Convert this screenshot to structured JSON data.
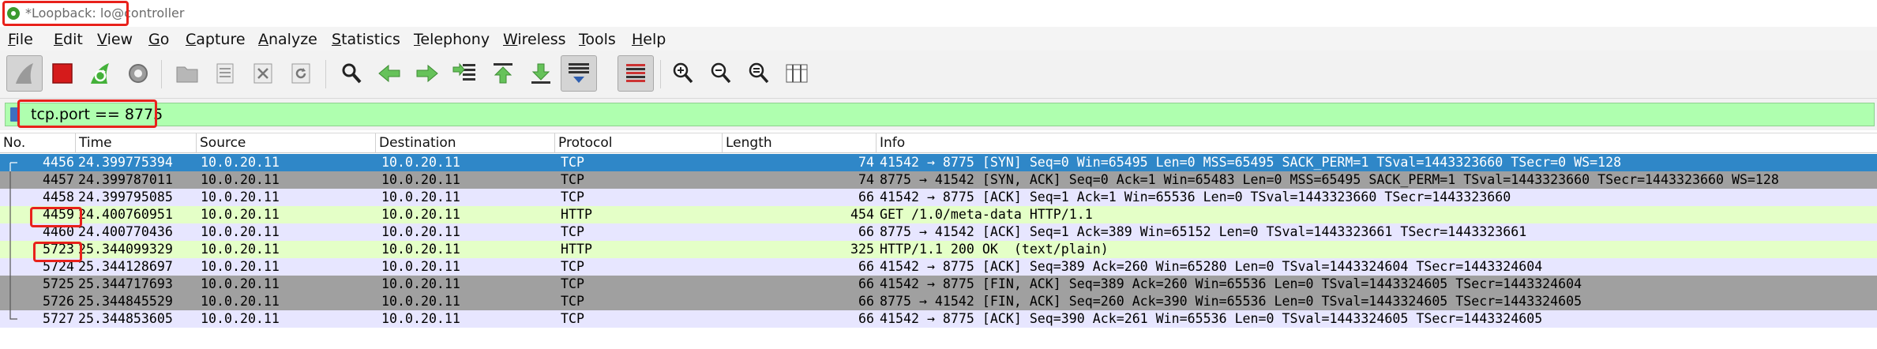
{
  "window": {
    "title": "*Loopback: lo@controller"
  },
  "menu": [
    "File",
    "Edit",
    "View",
    "Go",
    "Capture",
    "Analyze",
    "Statistics",
    "Telephony",
    "Wireless",
    "Tools",
    "Help"
  ],
  "toolbar": {
    "icons": [
      "shark-fin-start-icon",
      "stop-square-icon",
      "restart-fin-icon",
      "capture-options-gear-icon",
      "open-folder-icon",
      "save-file-icon",
      "close-file-icon",
      "reload-icon",
      "find-magnifier-icon",
      "go-back-arrow-icon",
      "go-forward-arrow-icon",
      "go-to-packet-icon",
      "first-packet-icon",
      "last-packet-icon",
      "autoscroll-icon",
      "colorize-icon",
      "zoom-in-icon",
      "zoom-out-icon",
      "normal-size-icon",
      "resize-columns-icon"
    ]
  },
  "filter": {
    "value": "tcp.port == 8775"
  },
  "columns": [
    "No.",
    "Time",
    "Source",
    "Destination",
    "Protocol",
    "Length",
    "Info"
  ],
  "rows": [
    {
      "no": "4456",
      "time": "24.399775394",
      "src": "10.0.20.11",
      "dst": "10.0.20.11",
      "proto": "TCP",
      "len": "74",
      "info": "41542 → 8775 [SYN] Seq=0 Win=65495 Len=0 MSS=65495 SACK_PERM=1 TSval=1443323660 TSecr=0 WS=128",
      "style": "selected"
    },
    {
      "no": "4457",
      "time": "24.399787011",
      "src": "10.0.20.11",
      "dst": "10.0.20.11",
      "proto": "TCP",
      "len": "74",
      "info": "8775 → 41542 [SYN, ACK] Seq=0 Ack=1 Win=65483 Len=0 MSS=65495 SACK_PERM=1 TSval=1443323660 TSecr=1443323660 WS=128",
      "style": "dark"
    },
    {
      "no": "4458",
      "time": "24.399795085",
      "src": "10.0.20.11",
      "dst": "10.0.20.11",
      "proto": "TCP",
      "len": "66",
      "info": "41542 → 8775 [ACK] Seq=1 Ack=1 Win=65536 Len=0 TSval=1443323660 TSecr=1443323660",
      "style": "tcp"
    },
    {
      "no": "4459",
      "time": "24.400760951",
      "src": "10.0.20.11",
      "dst": "10.0.20.11",
      "proto": "HTTP",
      "len": "454",
      "info": "GET /1.0/meta-data HTTP/1.1",
      "style": "http"
    },
    {
      "no": "4460",
      "time": "24.400770436",
      "src": "10.0.20.11",
      "dst": "10.0.20.11",
      "proto": "TCP",
      "len": "66",
      "info": "8775 → 41542 [ACK] Seq=1 Ack=389 Win=65152 Len=0 TSval=1443323661 TSecr=1443323661",
      "style": "tcp"
    },
    {
      "no": "5723",
      "time": "25.344099329",
      "src": "10.0.20.11",
      "dst": "10.0.20.11",
      "proto": "HTTP",
      "len": "325",
      "info": "HTTP/1.1 200 OK  (text/plain)",
      "style": "http"
    },
    {
      "no": "5724",
      "time": "25.344128697",
      "src": "10.0.20.11",
      "dst": "10.0.20.11",
      "proto": "TCP",
      "len": "66",
      "info": "41542 → 8775 [ACK] Seq=389 Ack=260 Win=65280 Len=0 TSval=1443324604 TSecr=1443324604",
      "style": "tcp"
    },
    {
      "no": "5725",
      "time": "25.344717693",
      "src": "10.0.20.11",
      "dst": "10.0.20.11",
      "proto": "TCP",
      "len": "66",
      "info": "41542 → 8775 [FIN, ACK] Seq=389 Ack=260 Win=65536 Len=0 TSval=1443324605 TSecr=1443324604",
      "style": "dark"
    },
    {
      "no": "5726",
      "time": "25.344845529",
      "src": "10.0.20.11",
      "dst": "10.0.20.11",
      "proto": "TCP",
      "len": "66",
      "info": "8775 → 41542 [FIN, ACK] Seq=260 Ack=390 Win=65536 Len=0 TSval=1443324605 TSecr=1443324605",
      "style": "dark"
    },
    {
      "no": "5727",
      "time": "25.344853605",
      "src": "10.0.20.11",
      "dst": "10.0.20.11",
      "proto": "TCP",
      "len": "66",
      "info": "41542 → 8775 [ACK] Seq=390 Ack=261 Win=65536 Len=0 TSval=1443324605 TSecr=1443324605",
      "style": "tcp"
    }
  ],
  "colors": {
    "selected_bg": "#2f87c8",
    "selected_fg": "#ffffff",
    "dark_bg": "#a0a0a0",
    "tcp_bg": "#e7e6ff",
    "http_bg": "#e4ffc7",
    "filter_bg": "#afffaf",
    "highlight": "#e8211b"
  }
}
